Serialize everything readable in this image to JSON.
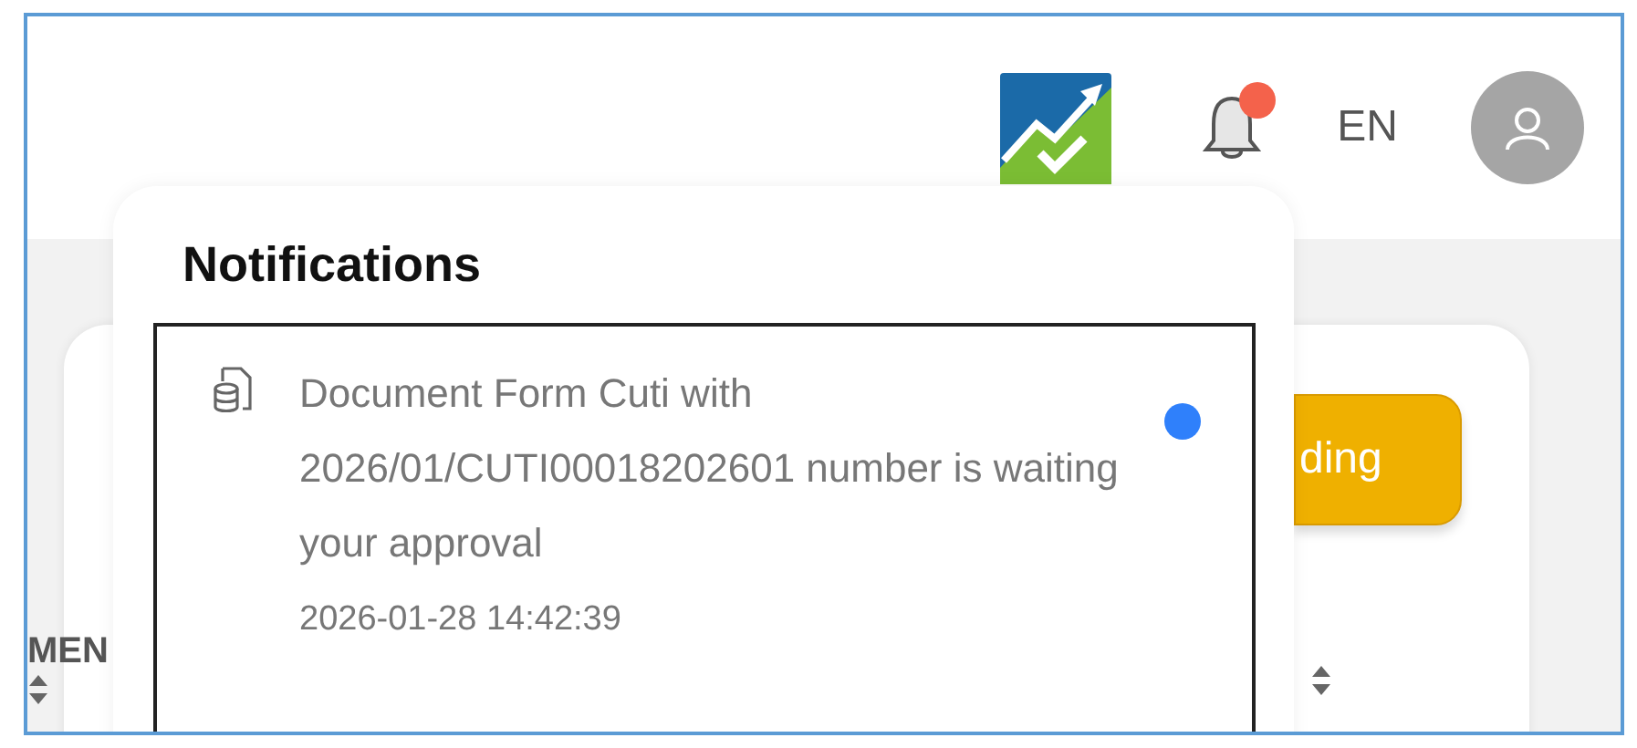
{
  "header": {
    "language": "EN",
    "notification_badge": true
  },
  "background": {
    "column_header": "MEN",
    "status_button": "ding"
  },
  "notifications": {
    "title": "Notifications",
    "items": [
      {
        "message": "Document Form Cuti with 2026/01/CUTI00018202601 number is waiting your approval",
        "time": "2026-01-28 14:42:39",
        "unread": true
      }
    ]
  }
}
